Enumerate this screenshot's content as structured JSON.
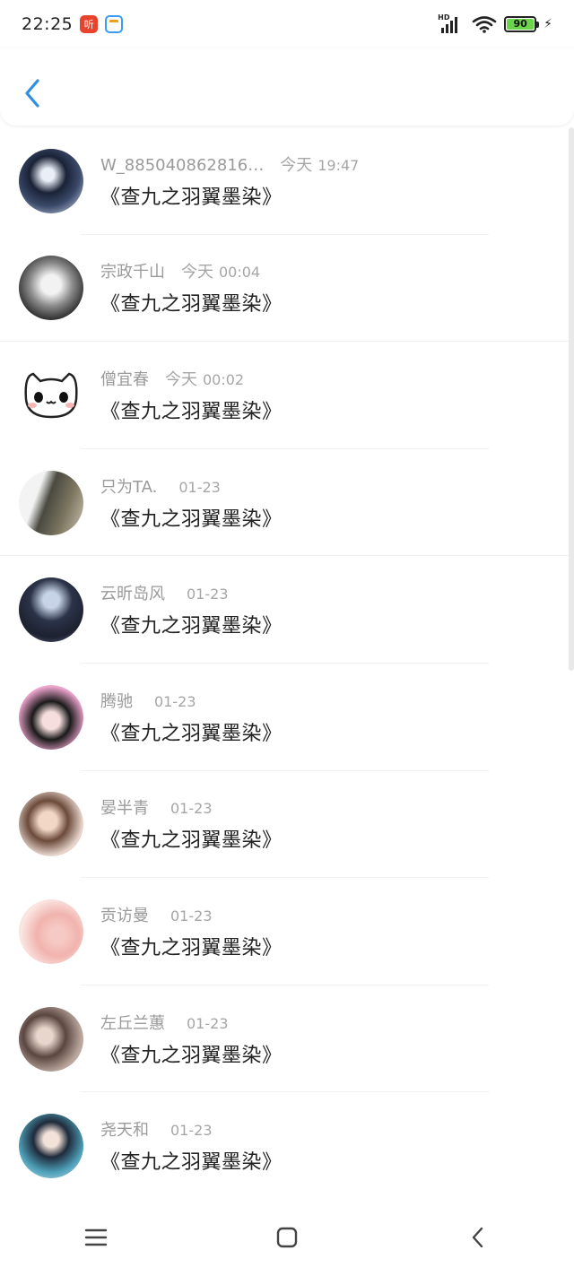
{
  "status_bar": {
    "time": "22:25",
    "app_badge_1": "听",
    "hd_label": "HD",
    "battery": "90"
  },
  "colors": {
    "accent": "#2f8fe6",
    "divider": "#f1f1f1",
    "meta_text": "#9a9a9a"
  },
  "header": {
    "back_icon": "chevron-left-icon"
  },
  "notifications": [
    {
      "name": "W_885040862816…",
      "day": "今天",
      "time": "19:47",
      "comment": "《查九之羽翼墨染》",
      "avatar": "avatar-1"
    },
    {
      "name": "宗政千山",
      "day": "今天",
      "time": "00:04",
      "comment": "《查九之羽翼墨染》",
      "avatar": "avatar-2"
    },
    {
      "name": "僧宜春",
      "day": "今天",
      "time": "00:02",
      "comment": "《查九之羽翼墨染》",
      "avatar": "avatar-3"
    },
    {
      "name": "只为TA.",
      "day": "",
      "time": "01-23",
      "comment": "《查九之羽翼墨染》",
      "avatar": "avatar-4"
    },
    {
      "name": "云昕岛风",
      "day": "",
      "time": "01-23",
      "comment": "《查九之羽翼墨染》",
      "avatar": "avatar-5"
    },
    {
      "name": "腾驰",
      "day": "",
      "time": "01-23",
      "comment": "《查九之羽翼墨染》",
      "avatar": "avatar-6"
    },
    {
      "name": "晏半青",
      "day": "",
      "time": "01-23",
      "comment": "《查九之羽翼墨染》",
      "avatar": "avatar-7"
    },
    {
      "name": "贡访曼",
      "day": "",
      "time": "01-23",
      "comment": "《查九之羽翼墨染》",
      "avatar": "avatar-8"
    },
    {
      "name": "左丘兰蕙",
      "day": "",
      "time": "01-23",
      "comment": "《查九之羽翼墨染》",
      "avatar": "avatar-9"
    },
    {
      "name": "尧天和",
      "day": "",
      "time": "01-23",
      "comment": "《查九之羽翼墨染》",
      "avatar": "avatar-10"
    }
  ],
  "nav_bar": {
    "menu_icon": "menu-icon",
    "home_icon": "home-icon",
    "back_icon": "back-icon"
  }
}
